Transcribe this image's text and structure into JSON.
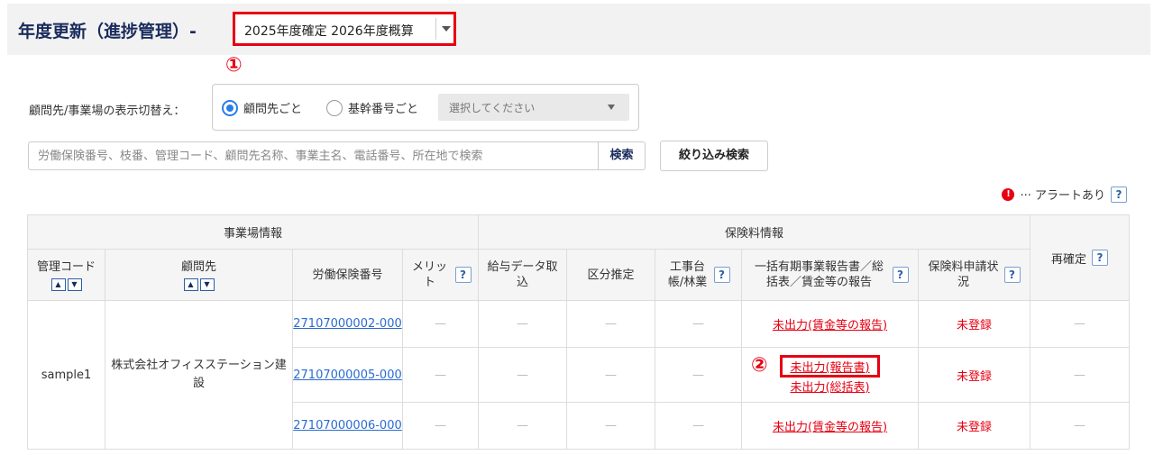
{
  "header": {
    "title": "年度更新（進捗管理）-",
    "year_select_value": "2025年度確定 2026年度概算"
  },
  "markers": {
    "m1": "①",
    "m2": "②"
  },
  "toggle": {
    "label": "顧問先/事業場の表示切替え：",
    "option_client": "顧問先ごと",
    "option_code": "基幹番号ごと",
    "code_select_placeholder": "選択してください",
    "selected": "顧問先ごと"
  },
  "search": {
    "placeholder": "労働保険番号、枝番、管理コード、顧問先名称、事業主名、電話番号、所在地で検索",
    "button": "検索",
    "filter_button": "絞り込み検索"
  },
  "legend": {
    "icon": "!",
    "text": "··· アラートあり",
    "help": "?"
  },
  "table": {
    "group_office": "事業場情報",
    "group_premium": "保険料情報",
    "col_code": "管理コード",
    "col_client": "顧問先",
    "col_insurance_no": "労働保険番号",
    "col_merit": "メリット",
    "col_payroll": "給与データ取込",
    "col_category": "区分推定",
    "col_ledger": "工事台帳/林業",
    "col_report": "一括有期事業報告書／総括表／賃金等の報告",
    "col_status": "保険料申請状況",
    "col_reconfirm": "再確定",
    "help": "?",
    "sort_up": "▲",
    "sort_down": "▼",
    "dash": "—",
    "client_code": "sample1",
    "client_name": "株式会社オフィスステーション建設",
    "rows": [
      {
        "no": "27107000002-000",
        "report1": "未出力(賃金等の報告)",
        "report2": "",
        "status": "未登録"
      },
      {
        "no": "27107000005-000",
        "report1": "未出力(報告書)",
        "report2": "未出力(総括表)",
        "status": "未登録"
      },
      {
        "no": "27107000006-000",
        "report1": "未出力(賃金等の報告)",
        "report2": "",
        "status": "未登録"
      }
    ]
  },
  "colors": {
    "accent_red": "#e60012",
    "link_blue": "#2b6bd0",
    "title_navy": "#1a2b5c"
  }
}
